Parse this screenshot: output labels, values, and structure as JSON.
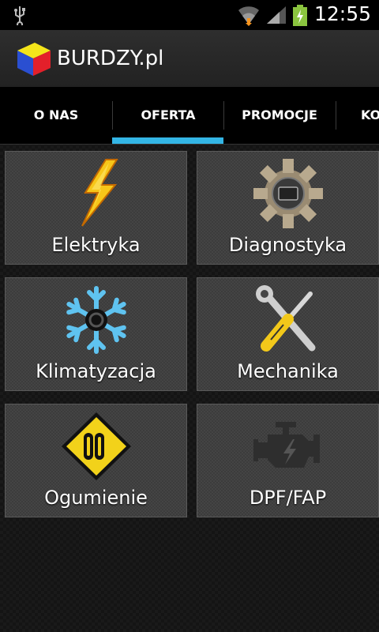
{
  "status_bar": {
    "time": "12:55"
  },
  "action_bar": {
    "title": "BURDZY.pl"
  },
  "tabs": [
    {
      "label": "O NAS"
    },
    {
      "label": "OFERTA",
      "selected": true
    },
    {
      "label": "PROMOCJE"
    },
    {
      "label": "KO"
    }
  ],
  "tiles": [
    {
      "label": "Elektryka",
      "icon": "lightning-icon"
    },
    {
      "label": "Diagnostyka",
      "icon": "gear-diagnostics-icon"
    },
    {
      "label": "Klimatyzacja",
      "icon": "snowflake-icon"
    },
    {
      "label": "Mechanika",
      "icon": "wrench-screwdriver-icon"
    },
    {
      "label": "Ogumienie",
      "icon": "tire-sign-icon"
    },
    {
      "label": "DPF/FAP",
      "icon": "engine-icon"
    }
  ],
  "colors": {
    "accent": "#33b5e5",
    "lightning": "#f7c619",
    "snowflake": "#5fc3f0",
    "sign": "#f2d21a"
  }
}
